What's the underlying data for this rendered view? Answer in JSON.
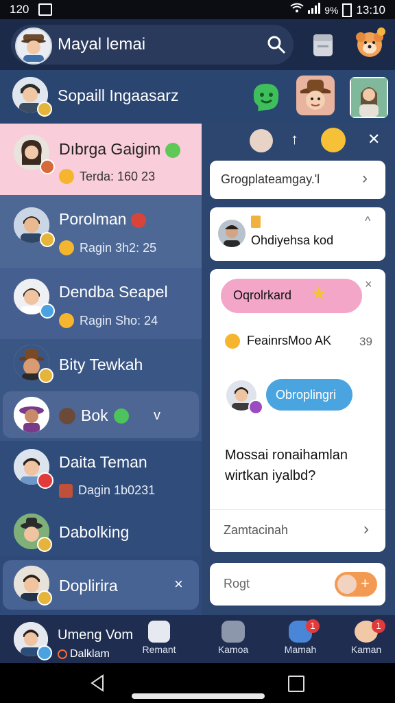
{
  "status_bar": {
    "time_left": "120",
    "battery": "%",
    "battery_level": "9",
    "time_right": "13:10"
  },
  "header": {
    "title": "Mayal lemai"
  },
  "group": {
    "title": "Sopaill Ingaasarz"
  },
  "chats": [
    {
      "name": "Dıbrga Gaigim",
      "sub": "Terda: 160 23"
    },
    {
      "name": "Porolman",
      "sub": "Ragin 3h2: 25"
    },
    {
      "name": "Dendba Seapel",
      "sub": "Ragin Sho: 24"
    },
    {
      "name": "Bity Tewkah",
      "sub": ""
    },
    {
      "name": "Bok",
      "sub": "",
      "extra": "v"
    },
    {
      "name": "Daita Teman",
      "sub": "Dagin 1b0231"
    },
    {
      "name": "Dabolking",
      "sub": ""
    },
    {
      "name": "Doplirira",
      "sub": "",
      "extra": "×"
    }
  ],
  "panel": {
    "top_arrow": "↑",
    "top_close": "✕",
    "card1_text": "Grogplateamgay.'l",
    "card1_chev": "›",
    "card2_text": "Ohdiyehsa kod",
    "card2_close": "^",
    "card3_bubble": "Oqrolrkard",
    "card3_close": "×",
    "card3_line": "FeainrsMoo AK",
    "card3_num": "39",
    "card3_chip": "Obroplingri",
    "card3_question": "Mossai ronaihamlan wirtkan iyalbd?",
    "card3_footer": "Zamtacinah",
    "card3_footer_chev": "›",
    "input_placeholder": "Rogt",
    "input_add": "+"
  },
  "bottom_nav": {
    "profile_name": "Umeng Vom",
    "profile_sub": "Dalklam",
    "items": [
      "Remant",
      "Kamoa",
      "Mamah",
      "Kaman"
    ],
    "badge1": "1",
    "badge2": "1"
  },
  "colors": {
    "accent_selected": "#f9cdd9",
    "primary": "#2f4a78",
    "chip_blue": "#49a4e0",
    "bubble_pink": "#f3a6c8"
  }
}
